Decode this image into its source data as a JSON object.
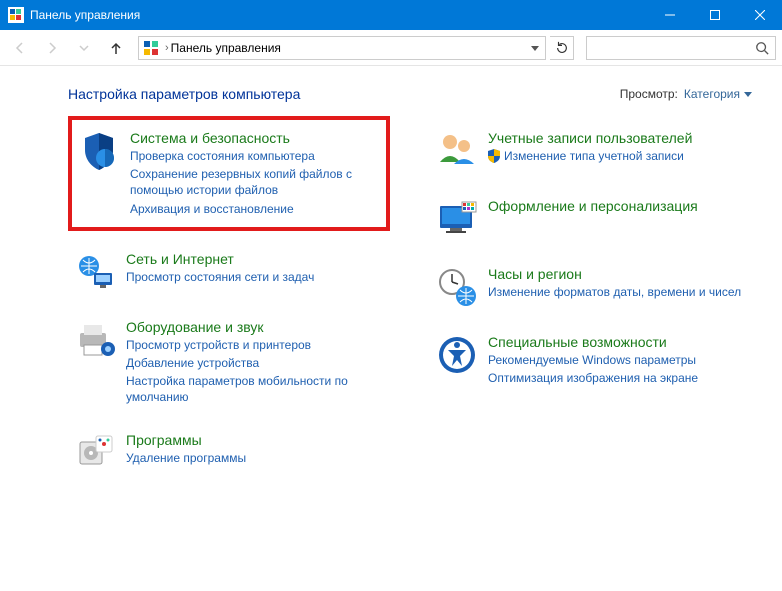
{
  "window": {
    "title": "Панель управления"
  },
  "address": {
    "path": "Панель управления"
  },
  "header": {
    "page_title": "Настройка параметров компьютера",
    "view_label": "Просмотр:",
    "view_value": "Категория"
  },
  "left": [
    {
      "title": "Система и безопасность",
      "links": [
        "Проверка состояния компьютера",
        "Сохранение резервных копий файлов с помощью истории файлов",
        "Архивация и восстановление"
      ],
      "highlighted": true
    },
    {
      "title": "Сеть и Интернет",
      "links": [
        "Просмотр состояния сети и задач"
      ]
    },
    {
      "title": "Оборудование и звук",
      "links": [
        "Просмотр устройств и принтеров",
        "Добавление устройства",
        "Настройка параметров мобильности по умолчанию"
      ]
    },
    {
      "title": "Программы",
      "links": [
        "Удаление программы"
      ]
    }
  ],
  "right": [
    {
      "title": "Учетные записи пользователей",
      "links": [
        "Изменение типа учетной записи"
      ],
      "shield": true
    },
    {
      "title": "Оформление и персонализация",
      "links": []
    },
    {
      "title": "Часы и регион",
      "links": [
        "Изменение форматов даты, времени и чисел"
      ]
    },
    {
      "title": "Специальные возможности",
      "links": [
        "Рекомендуемые Windows параметры",
        "Оптимизация изображения на экране"
      ]
    }
  ]
}
